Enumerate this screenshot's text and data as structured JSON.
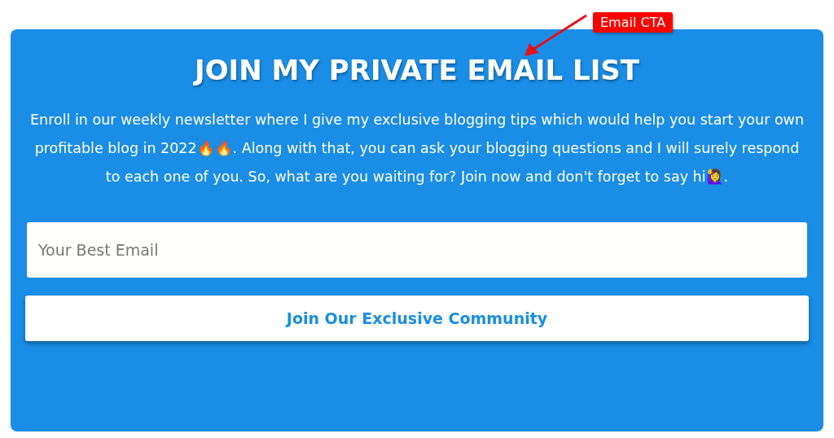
{
  "annotation": {
    "label": "Email CTA"
  },
  "signup": {
    "title": "JOIN MY PRIVATE EMAIL LIST",
    "description": "Enroll in our weekly newsletter where I give my exclusive blogging tips which would help you start your own profitable blog in 2022🔥🔥. Along with that, you can ask your blogging questions and I will surely respond to each one of you. So, what are you waiting for? Join now and don't forget to say hi🙋‍♀️.",
    "email_field": {
      "placeholder": "Your Best Email"
    },
    "submit_button": "Join Our Exclusive Community"
  }
}
